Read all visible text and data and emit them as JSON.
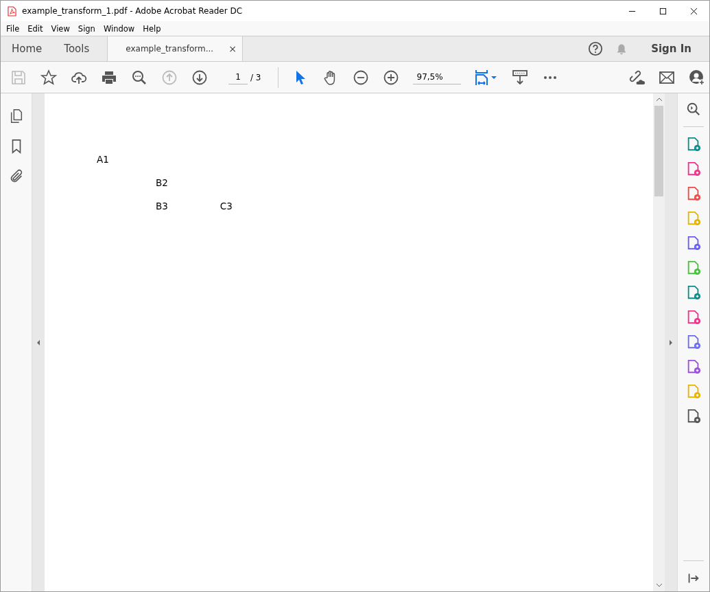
{
  "window": {
    "title": "example_transform_1.pdf - Adobe Acrobat Reader DC"
  },
  "menu": [
    "File",
    "Edit",
    "View",
    "Sign",
    "Window",
    "Help"
  ],
  "tabs": [
    {
      "label": "Home",
      "kind": "nav",
      "selected": false
    },
    {
      "label": "Tools",
      "kind": "nav",
      "selected": false
    },
    {
      "label": "example_transform...",
      "kind": "document",
      "selected": true,
      "close": "×"
    }
  ],
  "sign_in": "Sign In",
  "toolbar": {
    "page": "1",
    "page_total": "/ 3",
    "zoom": "97,5%"
  },
  "document": {
    "rows": [
      [
        "A1"
      ],
      [
        "B2"
      ],
      [
        "B3",
        "C3"
      ]
    ]
  }
}
